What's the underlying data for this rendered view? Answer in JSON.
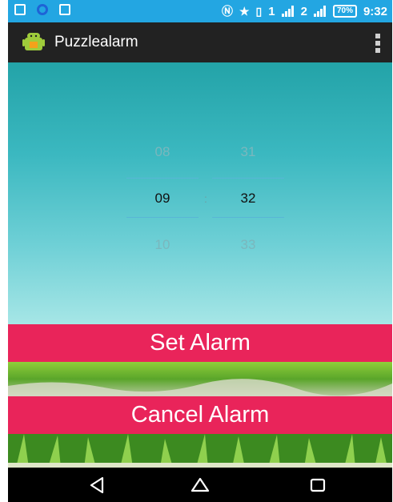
{
  "status_bar": {
    "battery": "70%",
    "time": "9:32",
    "signal_1": "1",
    "signal_2": "2"
  },
  "action_bar": {
    "title": "Puzzlealarm"
  },
  "time_picker": {
    "hours": [
      "08",
      "09",
      "10"
    ],
    "minutes": [
      "31",
      "32",
      "33"
    ],
    "separator": ":"
  },
  "buttons": {
    "set_alarm": "Set Alarm",
    "cancel_alarm": "Cancel Alarm"
  },
  "colors": {
    "status_bar": "#23a6e2",
    "accent_button": "#e9245a",
    "action_bar": "#222222"
  }
}
